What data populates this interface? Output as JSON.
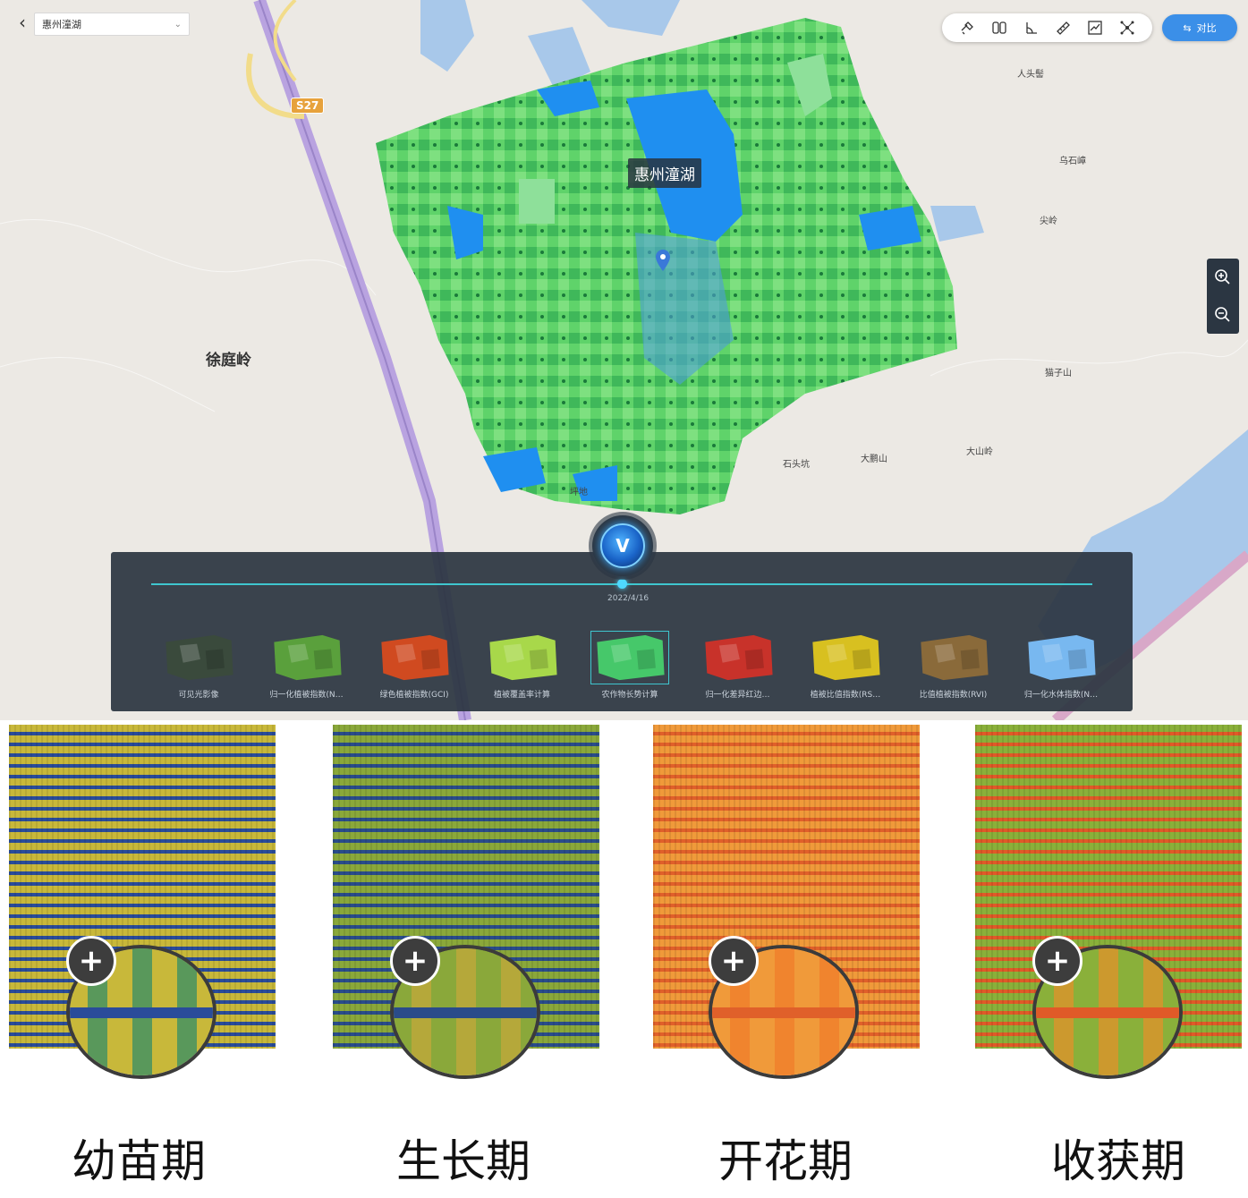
{
  "header": {
    "back_icon": "chevron-left-icon",
    "layer_select_value": "惠州潼湖"
  },
  "toolbar": {
    "tools": [
      "satellite-icon",
      "split-view-icon",
      "measure-angle-icon",
      "ruler-icon",
      "chart-icon",
      "network-icon"
    ],
    "compare_label": "对比"
  },
  "zoom": {
    "in_icon": "zoom-in-icon",
    "out_icon": "zoom-out-icon"
  },
  "map": {
    "area_name": "惠州潼湖",
    "road_code": "S27",
    "places": [
      "徐庭岭",
      "人头髻",
      "乌石嶂",
      "尖岭",
      "猫子山",
      "大鹏山",
      "大山岭",
      "石头坑",
      "坪地"
    ]
  },
  "timeline": {
    "badge_letter": "V",
    "date": "2022/4/16",
    "thumbnails": [
      {
        "label": "可见光影像",
        "color": "#3a4a3c"
      },
      {
        "label": "归一化植被指数(N…",
        "color": "#5aa03c"
      },
      {
        "label": "绿色植被指数(GCI)",
        "color": "#d04a20"
      },
      {
        "label": "植被覆盖率计算",
        "color": "#a8d84a"
      },
      {
        "label": "农作物长势计算",
        "color": "#46c86a"
      },
      {
        "label": "归一化差异红边…",
        "color": "#c8322a"
      },
      {
        "label": "植被比值指数(RS…",
        "color": "#d8c020"
      },
      {
        "label": "比值植被指数(RVI)",
        "color": "#8a6a3a"
      },
      {
        "label": "归一化水体指数(N…",
        "color": "#78b8f0"
      }
    ]
  },
  "stages": [
    {
      "label": "幼苗期",
      "base": "#2a8a6a",
      "stripe": "#c8b83a",
      "gap": "#2a4c9a"
    },
    {
      "label": "生长期",
      "base": "#c8a83a",
      "stripe": "#8aa83a",
      "gap": "#2a4c8a"
    },
    {
      "label": "开花期",
      "base": "#f07a2a",
      "stripe": "#f09a3a",
      "gap": "#e0602a"
    },
    {
      "label": "收获期",
      "base": "#e8902a",
      "stripe": "#8ab03a",
      "gap": "#e05a28"
    }
  ]
}
